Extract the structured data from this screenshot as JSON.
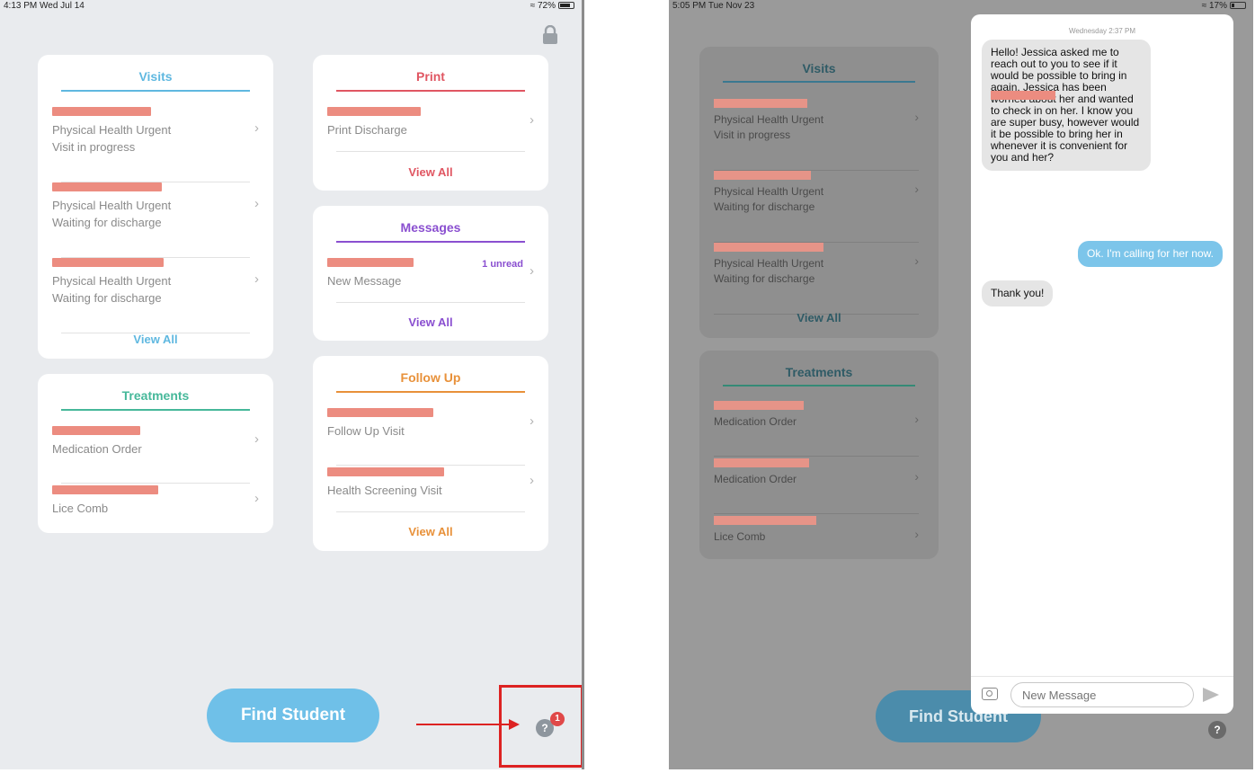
{
  "left": {
    "status": {
      "time": "4:13 PM  Wed Jul 14",
      "battery": "72%"
    },
    "visits": {
      "title": "Visits",
      "items": [
        {
          "line1": "Physical Health Urgent",
          "line2": "Visit in progress"
        },
        {
          "line1": "Physical Health Urgent",
          "line2": "Waiting for discharge"
        },
        {
          "line1": "Physical Health Urgent",
          "line2": "Waiting for discharge"
        }
      ],
      "view_all": "View All"
    },
    "treatments": {
      "title": "Treatments",
      "items": [
        {
          "line1": "Medication Order"
        },
        {
          "line1": "Lice Comb"
        }
      ]
    },
    "print": {
      "title": "Print",
      "items": [
        {
          "line1": "Print Discharge"
        }
      ],
      "view_all": "View All"
    },
    "messages": {
      "title": "Messages",
      "items": [
        {
          "line1": "New Message",
          "badge": "1 unread"
        }
      ],
      "view_all": "View All"
    },
    "follow_up": {
      "title": "Follow Up",
      "items": [
        {
          "line1": "Follow Up Visit"
        },
        {
          "line1": "Health Screening Visit"
        }
      ],
      "view_all": "View All"
    },
    "find_student": "Find Student",
    "help_icon": "?",
    "notification_count": "1"
  },
  "right": {
    "status": {
      "time": "5:05 PM  Tue Nov 23",
      "battery": "17%"
    },
    "visits": {
      "title": "Visits",
      "items": [
        {
          "line1": "Physical Health Urgent",
          "line2": "Visit in progress"
        },
        {
          "line1": "Physical Health Urgent",
          "line2": "Waiting for discharge"
        },
        {
          "line1": "Physical Health Urgent",
          "line2": "Waiting for discharge"
        }
      ],
      "view_all": "View All"
    },
    "treatments": {
      "title": "Treatments",
      "items": [
        {
          "line1": "Medication Order"
        },
        {
          "line1": "Medication Order"
        },
        {
          "line1": "Lice Comb"
        }
      ]
    },
    "conversation": {
      "date_label": "Wednesday 2:37 PM",
      "messages": [
        {
          "dir": "in",
          "text": "Hello! Jessica asked me to reach out to you to see if it would be possible to bring                in again. Jessica has been worried about her and wanted to check in on her. I know you are super busy, however would it be possible to bring her in whenever it is convenient for you and her?"
        },
        {
          "dir": "out",
          "text": "Ok. I'm calling for her now."
        },
        {
          "dir": "in",
          "text": "Thank you!"
        }
      ],
      "input_placeholder": "New Message"
    },
    "find_student": "Find Student",
    "help_icon": "?"
  },
  "colors": {
    "visits": "#5fb8e0",
    "treatments": "#46b89a",
    "print": "#e05662",
    "messages": "#8a4fd0",
    "follow_up": "#e8913a",
    "find_button": "#6fc0e8",
    "highlight": "#dd2222"
  },
  "icons": [
    "lock-icon",
    "chevron-right-icon",
    "help-icon",
    "camera-icon",
    "send-icon"
  ]
}
